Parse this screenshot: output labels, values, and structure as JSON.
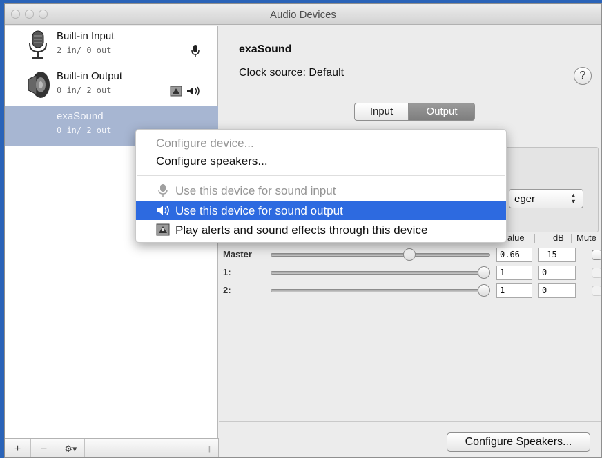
{
  "window": {
    "title": "Audio Devices"
  },
  "devices": [
    {
      "name": "Built-in Input",
      "io": "2 in/ 0 out",
      "icon": "microphone-icon",
      "badge": "microphone-icon"
    },
    {
      "name": "Built-in Output",
      "io": "0 in/ 2 out",
      "icon": "speaker-icon",
      "badge": "alert-and-speaker-icon"
    },
    {
      "name": "exaSound",
      "io": "0 in/ 2 out",
      "icon": "none",
      "badge": "none",
      "selected": true
    }
  ],
  "sidebar_footer": {
    "add": "+",
    "remove": "−",
    "gear_menu": "⚙▾",
    "grip": "|||"
  },
  "detail": {
    "device_title": "exaSound",
    "clock_source": "Clock source: Default",
    "help": "?",
    "tabs": [
      {
        "label": "Input"
      },
      {
        "label": "Output",
        "selected": true
      }
    ],
    "format_popup_visible_text": "eger",
    "columns": {
      "value": "alue",
      "db": "dB",
      "mute": "Mute"
    },
    "channels": [
      {
        "label": "Master",
        "value": "0.66",
        "db": "-15",
        "level": 0.66,
        "mute_enabled": true
      },
      {
        "label": "1:",
        "value": "1",
        "db": "0",
        "level": 1.0,
        "mute_enabled": false
      },
      {
        "label": "2:",
        "value": "1",
        "db": "0",
        "level": 1.0,
        "mute_enabled": false
      }
    ],
    "configure_speakers_button": "Configure Speakers..."
  },
  "context_menu": {
    "items": [
      {
        "label": "Configure device...",
        "enabled": false
      },
      {
        "label": "Configure speakers...",
        "enabled": true
      },
      {
        "label": "Use this device for sound input",
        "enabled": false,
        "icon": "microphone-icon"
      },
      {
        "label": "Use this device for sound output",
        "enabled": true,
        "highlighted": true,
        "icon": "speaker-icon"
      },
      {
        "label": "Play alerts and sound effects through this device",
        "enabled": true,
        "icon": "alert-icon"
      }
    ]
  },
  "colors": {
    "selection": "#2d6ae0",
    "sidebar_selected": "#a7b6d2",
    "desktop": "#2a63b8"
  }
}
